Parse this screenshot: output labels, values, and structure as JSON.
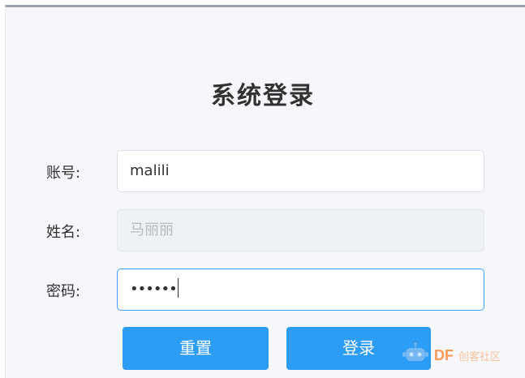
{
  "form": {
    "title": "系统登录",
    "fields": [
      {
        "label": "账号:",
        "value": "malili",
        "disabled": false,
        "focused": false
      },
      {
        "label": "姓名:",
        "placeholder": "马丽丽",
        "disabled": true,
        "focused": false
      },
      {
        "label": "密码:",
        "masked_value": "••••••",
        "disabled": false,
        "focused": true
      }
    ],
    "buttons": {
      "reset": "重置",
      "login": "登录"
    }
  },
  "watermark": {
    "brand": "DF",
    "text": "创客社区"
  },
  "colors": {
    "primary": "#2d9cf5",
    "focus_border": "#409eff",
    "panel_bg": "#f5f7fa",
    "text": "#303133",
    "disabled_bg": "#eef1f5"
  }
}
